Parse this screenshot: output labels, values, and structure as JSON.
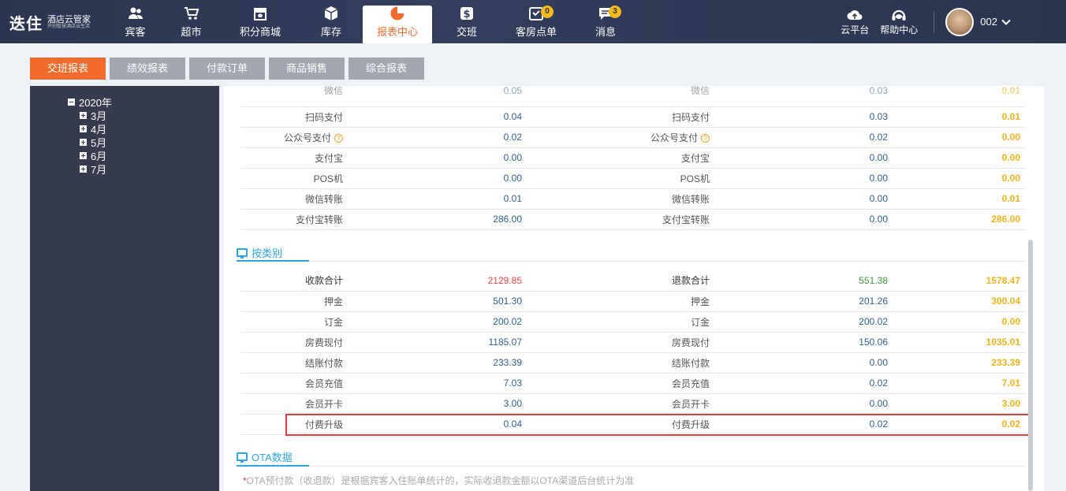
{
  "app": {
    "logo_main": "迭住",
    "logo_sub_line1": "酒店云管家",
    "logo_sub_line2": "开创智慧酒店云生活"
  },
  "nav": [
    {
      "label": "宾客",
      "icon": "guests-icon"
    },
    {
      "label": "超市",
      "icon": "cart-icon"
    },
    {
      "label": "积分商城",
      "icon": "store-icon"
    },
    {
      "label": "库存",
      "icon": "box-icon"
    },
    {
      "label": "报表中心",
      "icon": "pie-chart-icon",
      "active": true
    },
    {
      "label": "交班",
      "icon": "shift-icon"
    },
    {
      "label": "客房点单",
      "icon": "room-order-icon",
      "badge": "0"
    },
    {
      "label": "消息",
      "icon": "message-icon",
      "badge": "3"
    }
  ],
  "tools": {
    "cloud": "云平台",
    "help": "帮助中心",
    "user": "002"
  },
  "tabs": [
    "交班报表",
    "绩效报表",
    "付款订单",
    "商品销售",
    "综合报表"
  ],
  "tree": {
    "year": "2020年",
    "months": [
      "3月",
      "4月",
      "5月",
      "6月",
      "7月"
    ]
  },
  "payment_rows_cut": {
    "label": "微信",
    "v1": "0.05",
    "v2": "0.03",
    "net": "0.01"
  },
  "payment_rows": [
    {
      "label": "扫码支付",
      "v1": "0.04",
      "label2": "扫码支付",
      "v2": "0.03",
      "net": "0.01",
      "help": false
    },
    {
      "label": "公众号支付",
      "v1": "0.02",
      "label2": "公众号支付",
      "v2": "0.02",
      "net": "0.00",
      "help": true
    },
    {
      "label": "支付宝",
      "v1": "0.00",
      "label2": "支付宝",
      "v2": "0.00",
      "net": "0.00",
      "help": false
    },
    {
      "label": "POS机",
      "v1": "0.00",
      "label2": "POS机",
      "v2": "0.00",
      "net": "0.00",
      "help": false
    },
    {
      "label": "微信转账",
      "v1": "0.01",
      "label2": "微信转账",
      "v2": "0.00",
      "net": "0.01",
      "help": false
    },
    {
      "label": "支付宝转账",
      "v1": "286.00",
      "label2": "支付宝转账",
      "v2": "0.00",
      "net": "286.00",
      "help": false
    }
  ],
  "section_category": "按类别",
  "category_total": {
    "label": "收款合计",
    "v1": "2129.85",
    "label2": "退款合计",
    "v2": "551.38",
    "net": "1578.47"
  },
  "category_rows": [
    {
      "label": "押金",
      "v1": "501.30",
      "label2": "押金",
      "v2": "201.26",
      "net": "300.04"
    },
    {
      "label": "订金",
      "v1": "200.02",
      "label2": "订金",
      "v2": "200.02",
      "net": "0.00"
    },
    {
      "label": "房费现付",
      "v1": "1185.07",
      "label2": "房费现付",
      "v2": "150.06",
      "net": "1035.01"
    },
    {
      "label": "结账付款",
      "v1": "233.39",
      "label2": "结账付款",
      "v2": "0.00",
      "net": "233.39"
    },
    {
      "label": "会员充值",
      "v1": "7.03",
      "label2": "会员充值",
      "v2": "0.02",
      "net": "7.01"
    },
    {
      "label": "会员开卡",
      "v1": "3.00",
      "label2": "会员开卡",
      "v2": "0.00",
      "net": "3.00"
    },
    {
      "label": "付费升级",
      "v1": "0.04",
      "label2": "付费升级",
      "v2": "0.02",
      "net": "0.02"
    }
  ],
  "section_ota": "OTA数据",
  "ota_note_star": "*",
  "ota_note": "OTA预付款（收退款）是根据宾客入住账单统计的，实际收退款金额以OTA渠道后台统计为准",
  "colors": {
    "accent": "#f26b2a",
    "net": "#f2b21b",
    "link": "#2d5e96",
    "section": "#2fa6e6"
  }
}
